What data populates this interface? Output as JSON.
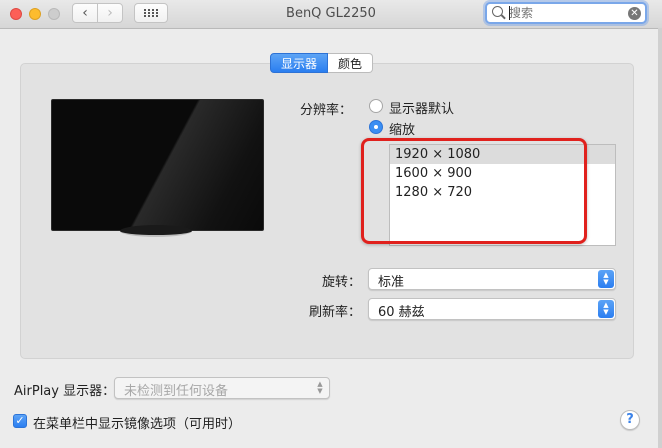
{
  "window": {
    "title": "BenQ GL2250",
    "search_placeholder": "搜索"
  },
  "tabs": [
    {
      "label": "显示器",
      "active": true
    },
    {
      "label": "颜色",
      "active": false
    }
  ],
  "resolution": {
    "label": "分辨率：",
    "options": [
      {
        "label": "显示器默认",
        "selected": false
      },
      {
        "label": "缩放",
        "selected": true
      }
    ],
    "scaled_list": [
      "1920 × 1080",
      "1600 × 900",
      "1280 × 720"
    ],
    "selected_index": 0
  },
  "rotation": {
    "label": "旋转：",
    "value": "标准"
  },
  "refresh_rate": {
    "label": "刷新率：",
    "value": "60 赫兹"
  },
  "airplay": {
    "label": "AirPlay 显示器：",
    "value": "未检测到任何设备"
  },
  "mirroring_option": {
    "label": "在菜单栏中显示镜像选项（可用时）",
    "checked": true
  },
  "help": {
    "label": "?"
  },
  "colors": {
    "accent": "#2a7ef0",
    "highlight_box": "#e0211d"
  }
}
